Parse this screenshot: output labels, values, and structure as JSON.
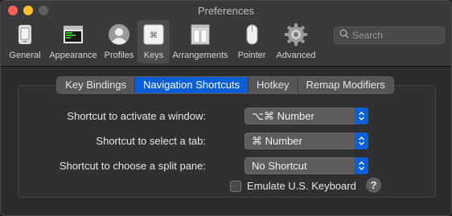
{
  "window": {
    "title": "Preferences"
  },
  "toolbar": {
    "items": [
      {
        "label": "General",
        "icon": "general-icon"
      },
      {
        "label": "Appearance",
        "icon": "appearance-icon"
      },
      {
        "label": "Profiles",
        "icon": "profiles-icon"
      },
      {
        "label": "Keys",
        "icon": "keys-icon",
        "selected": true
      },
      {
        "label": "Arrangements",
        "icon": "arrangements-icon"
      },
      {
        "label": "Pointer",
        "icon": "pointer-icon"
      },
      {
        "label": "Advanced",
        "icon": "gear-icon"
      }
    ]
  },
  "search": {
    "placeholder": "Search",
    "value": ""
  },
  "tabs": [
    {
      "label": "Key Bindings",
      "active": false
    },
    {
      "label": "Navigation Shortcuts",
      "active": true
    },
    {
      "label": "Hotkey",
      "active": false
    },
    {
      "label": "Remap Modifiers",
      "active": false
    }
  ],
  "settings": [
    {
      "label": "Shortcut to activate a window:",
      "value": "⌥⌘ Number"
    },
    {
      "label": "Shortcut to select a tab:",
      "value": "⌘ Number"
    },
    {
      "label": "Shortcut to choose a split pane:",
      "value": "No Shortcut"
    }
  ],
  "emulate_us_keyboard": {
    "label": "Emulate U.S. Keyboard",
    "checked": false
  },
  "help": {
    "label": "?"
  },
  "colors": {
    "accent": "#0a5fd6",
    "window_bg": "#2b2b2d",
    "toolbar_bg": "#3a3a3c"
  }
}
